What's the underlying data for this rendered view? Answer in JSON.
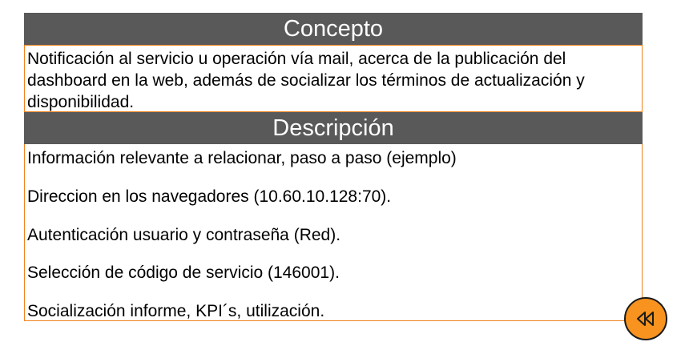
{
  "concept": {
    "title": "Concepto",
    "text": "Notificación al servicio u operación vía mail, acerca de la publicación del dashboard en la web, además de socializar los términos de actualización y disponibilidad."
  },
  "description": {
    "title": "Descripción",
    "items": [
      "Información relevante a relacionar, paso a paso (ejemplo)",
      "Direccion en los navegadores (10.60.10.128:70).",
      "Autenticación usuario y contraseña (Red).",
      "Selección de código de servicio (146001).",
      "Socialización informe, KPI´s, utilización."
    ]
  },
  "back_button": {
    "icon": "rewind-icon"
  },
  "colors": {
    "header_bg": "#595959",
    "border": "#f0821e",
    "button": "#f7931e"
  }
}
